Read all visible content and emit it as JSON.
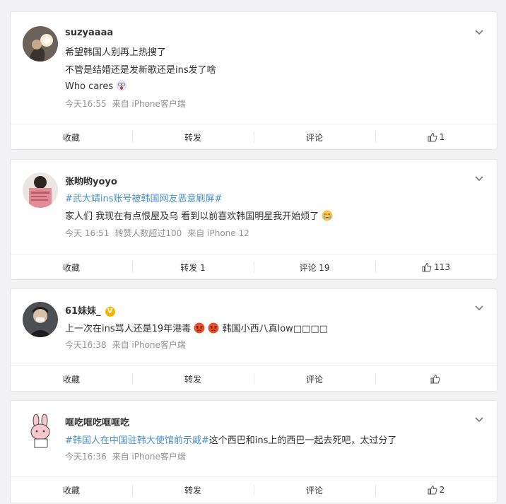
{
  "posts": [
    {
      "username": "suzyaaaa",
      "lines": [
        "希望韩国人别再上热搜了",
        "不管是结婚还是发新歌还是ins发了啥",
        "Who cares"
      ],
      "meta": [
        "今天16:55",
        "来自 iPhone客户端"
      ],
      "actions": {
        "collect": "收藏",
        "forward": "转发",
        "comment": "评论",
        "like": "1"
      }
    },
    {
      "username": "张哟哟yoyo",
      "hashtag": "#武大靖ins账号被韩国网友恶意刷屏#",
      "lines": [
        "家人们 我现在有点恨屋及乌 看到以前喜欢韩国明星我开始烦了"
      ],
      "meta": [
        "今天 16:51",
        "转赞人数超过100",
        "来自 iPhone 12"
      ],
      "actions": {
        "collect": "收藏",
        "forward": "转发 1",
        "comment": "评论 19",
        "like": "113"
      }
    },
    {
      "username": "61妹妹_",
      "verified_mark": "V",
      "line_a": "上一次在ins骂人还是19年港毒",
      "line_b": "韩国小西八真low□□□□",
      "meta": [
        "今天16:38",
        "来自 iPhone客户端"
      ],
      "actions": {
        "collect": "收藏",
        "forward": "转发",
        "comment": "评论",
        "like": ""
      }
    },
    {
      "username": "哐吃哐吃哐哐吃",
      "hashtag": "#韩国人在中国驻韩大使馆前示威#",
      "text_after": "这个西巴和ins上的西巴一起去死吧，太过分了",
      "meta": [
        "今天16:36",
        "来自 iPhone客户端"
      ],
      "actions": {
        "collect": "收藏",
        "forward": "转发",
        "comment": "评论",
        "like": "2"
      }
    }
  ],
  "icons": {
    "chevron": "chevron-down-icon",
    "like": "thumbs-up-icon"
  },
  "colors": {
    "link": "#4a90c8",
    "meta": "#939393",
    "badge": "#f7b500"
  }
}
